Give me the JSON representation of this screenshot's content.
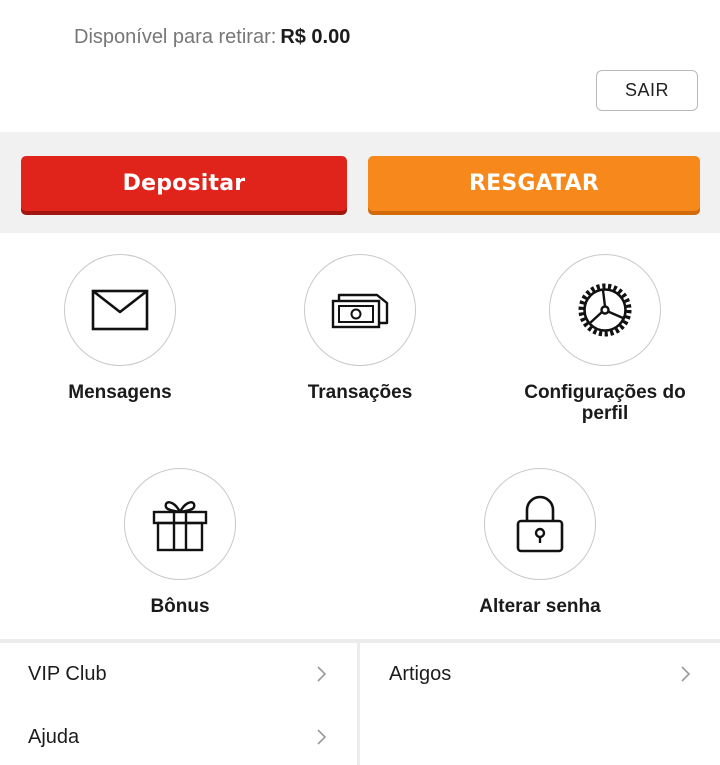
{
  "balance": {
    "label": "Disponível para retirar:",
    "value": "R$ 0.00"
  },
  "header": {
    "logout_label": "SAIR"
  },
  "actions": {
    "deposit_label": "Depositar",
    "withdraw_label": "RESGATAR",
    "deposit_color": "#e0241b",
    "withdraw_color": "#f7891c"
  },
  "menu": {
    "messages": {
      "label": "Mensagens",
      "icon": "envelope-icon"
    },
    "transactions": {
      "label": "Transações",
      "icon": "banknote-icon"
    },
    "profile_settings": {
      "label": "Configurações do perfil",
      "icon": "gear-icon"
    },
    "bonus": {
      "label": "Bônus",
      "icon": "gift-icon"
    },
    "change_password": {
      "label": "Alterar senha",
      "icon": "lock-icon"
    }
  },
  "links": {
    "vip_club": "VIP Club",
    "help": "Ajuda",
    "articles": "Artigos"
  }
}
